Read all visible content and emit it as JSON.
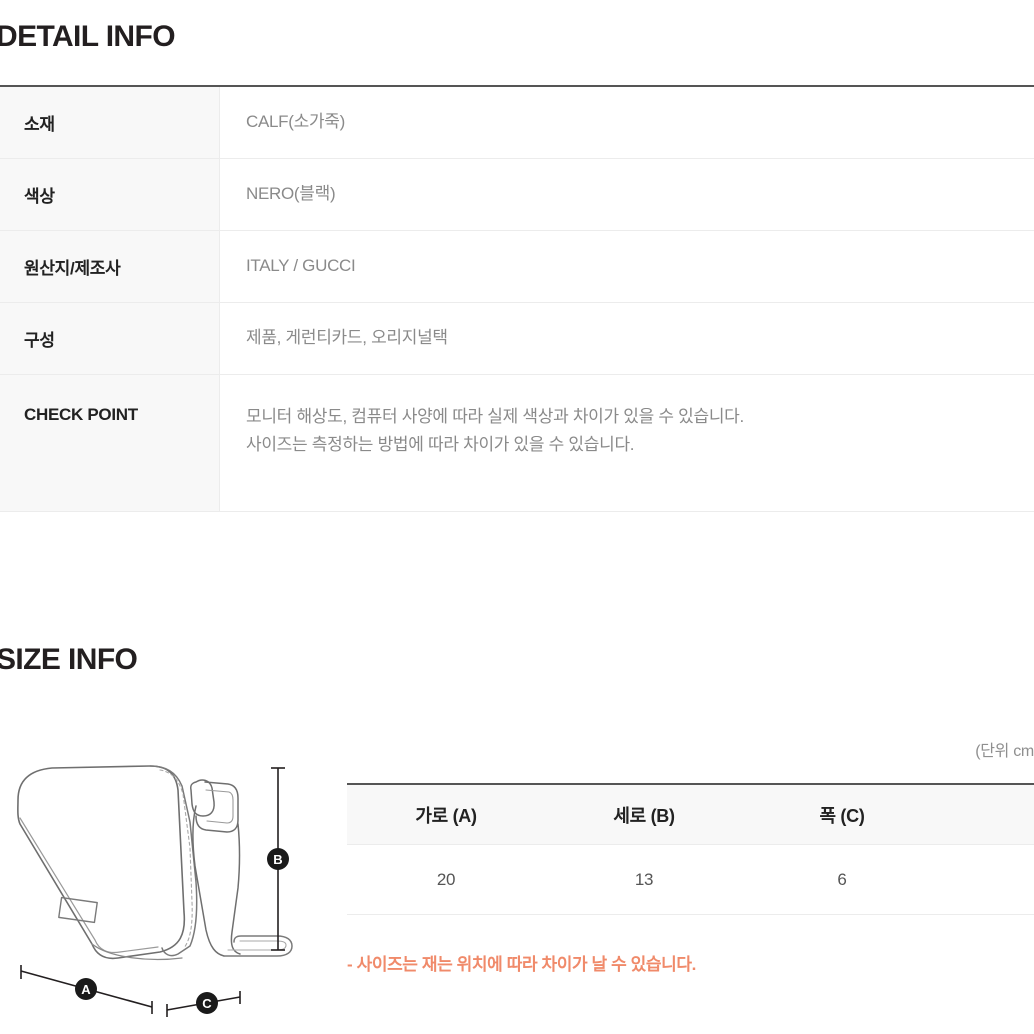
{
  "sections": {
    "detail": {
      "title": "DETAIL INFO",
      "rows": [
        {
          "label": "소재",
          "value": "CALF(소가죽)"
        },
        {
          "label": "색상",
          "value": "NERO(블랙)"
        },
        {
          "label": "원산지/제조사",
          "value": "ITALY / GUCCI"
        },
        {
          "label": "구성",
          "value": "제품, 게런티카드, 오리지널택"
        }
      ],
      "checkpoint": {
        "label": "CHECK POINT",
        "line1": "모니터 해상도, 컴퓨터 사양에 따라 실제 색상과 차이가 있을 수 있습니다.",
        "line2": "사이즈는 측정하는 방법에 따라 차이가 있을 수 있습니다."
      }
    },
    "size": {
      "title": "SIZE INFO",
      "unit_note": "(단위 cm)",
      "headers": [
        "가로 (A)",
        "세로 (B)",
        "폭 (C)"
      ],
      "values": [
        "20",
        "13",
        "6"
      ],
      "note": "- 사이즈는 재는 위치에 따라 차이가 날 수 있습니다.",
      "note_color": "#f08a6a",
      "markers": {
        "a": "A",
        "b": "B",
        "c": "C"
      }
    }
  },
  "chart_data": {
    "type": "table",
    "title": "SIZE INFO",
    "categories": [
      "가로 (A)",
      "세로 (B)",
      "폭 (C)"
    ],
    "values": [
      20,
      13,
      6
    ],
    "unit": "cm",
    "annotations": [
      "(단위 cm)",
      "- 사이즈는 재는 위치에 따라 차이가 날 수 있습니다."
    ]
  }
}
